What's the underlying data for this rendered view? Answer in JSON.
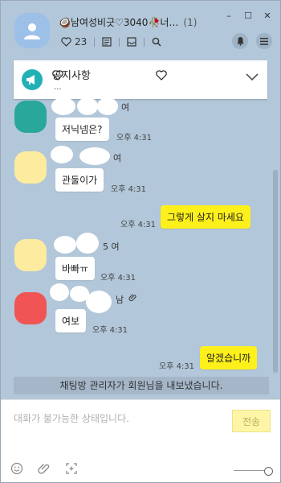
{
  "header": {
    "title": "🥥남여성비긋♡3040🥀너…",
    "count": "(1)",
    "likes": "23"
  },
  "notice": {
    "label": "공지사항",
    "dots": "..."
  },
  "messages": [
    {
      "name_suffix": "여",
      "text": "저닉넴은?",
      "time": "오후 4:31",
      "color": "#2aa79b"
    },
    {
      "name_suffix": "여",
      "text": "관둘이가",
      "time": "오후 4:31",
      "color": "#fdeba0"
    },
    {
      "text": "그렇게 살지 마세요",
      "time": "오후 4:31"
    },
    {
      "name_suffix": "5 여",
      "text": "바빠ㅠ",
      "time": "오후 4:31",
      "color": "#fdeba0"
    },
    {
      "name_suffix": "남",
      "text": "여보",
      "time": "오후 4:31",
      "color": "#f05454"
    },
    {
      "text": "알겠습니까",
      "time": "오후 4:31"
    }
  ],
  "system_message": "채팅방 관리자가 회원님을 내보냈습니다.",
  "input": {
    "placeholder": "대화가 불가능한 상태입니다.",
    "send_label": "전송"
  },
  "colors": {
    "background": "#b2c7d9",
    "my_bubble": "#fef01b",
    "notice_icon": "#21b1b5"
  }
}
